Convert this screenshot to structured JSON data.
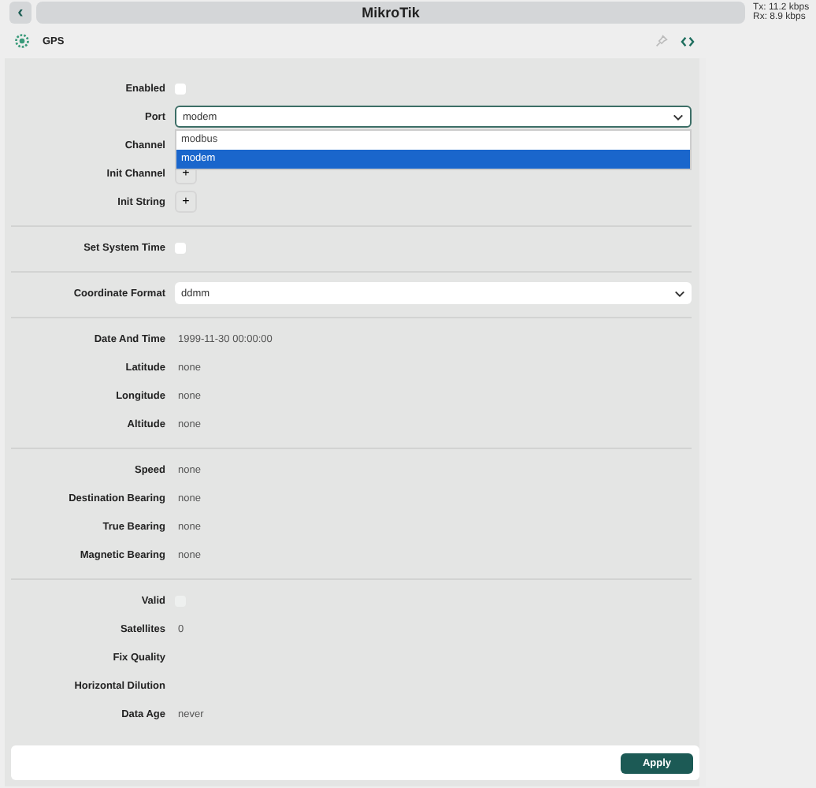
{
  "window": {
    "title": "MikroTik",
    "back_button": "‹",
    "traffic": [
      "Tx: 11.2 kbps",
      "Rx: 8.9 kbps"
    ]
  },
  "header": {
    "title": "GPS"
  },
  "sections": [
    [
      {
        "label": "Enabled",
        "kind": "checkbox",
        "checked": false
      },
      {
        "label": "Port",
        "kind": "select",
        "value": "modem",
        "expanded": true,
        "options": [
          {
            "label": "modbus",
            "selected": false
          },
          {
            "label": "modem",
            "selected": true
          }
        ]
      },
      {
        "label": "Channel",
        "kind": "covered"
      },
      {
        "label": "Init Channel",
        "kind": "add",
        "button": "+"
      },
      {
        "label": "Init String",
        "kind": "add",
        "button": "+"
      }
    ],
    [
      {
        "label": "Set System Time",
        "kind": "checkbox",
        "checked": false
      }
    ],
    [
      {
        "label": "Coordinate Format",
        "kind": "select",
        "value": "ddmm",
        "expanded": false
      }
    ],
    [
      {
        "label": "Date And Time",
        "kind": "text",
        "value": "1999-11-30 00:00:00"
      },
      {
        "label": "Latitude",
        "kind": "text",
        "value": "none"
      },
      {
        "label": "Longitude",
        "kind": "text",
        "value": "none"
      },
      {
        "label": "Altitude",
        "kind": "text",
        "value": "none"
      }
    ],
    [
      {
        "label": "Speed",
        "kind": "text",
        "value": "none"
      },
      {
        "label": "Destination Bearing",
        "kind": "text",
        "value": "none"
      },
      {
        "label": "True Bearing",
        "kind": "text",
        "value": "none"
      },
      {
        "label": "Magnetic Bearing",
        "kind": "text",
        "value": "none"
      }
    ],
    [
      {
        "label": "Valid",
        "kind": "checkbox",
        "checked": false,
        "disabled": true
      },
      {
        "label": "Satellites",
        "kind": "text",
        "value": "0"
      },
      {
        "label": "Fix Quality",
        "kind": "text"
      },
      {
        "label": "Horizontal Dilution",
        "kind": "text"
      },
      {
        "label": "Data Age",
        "kind": "text",
        "value": "never"
      }
    ]
  ],
  "footer": {
    "apply_button": "Apply"
  }
}
